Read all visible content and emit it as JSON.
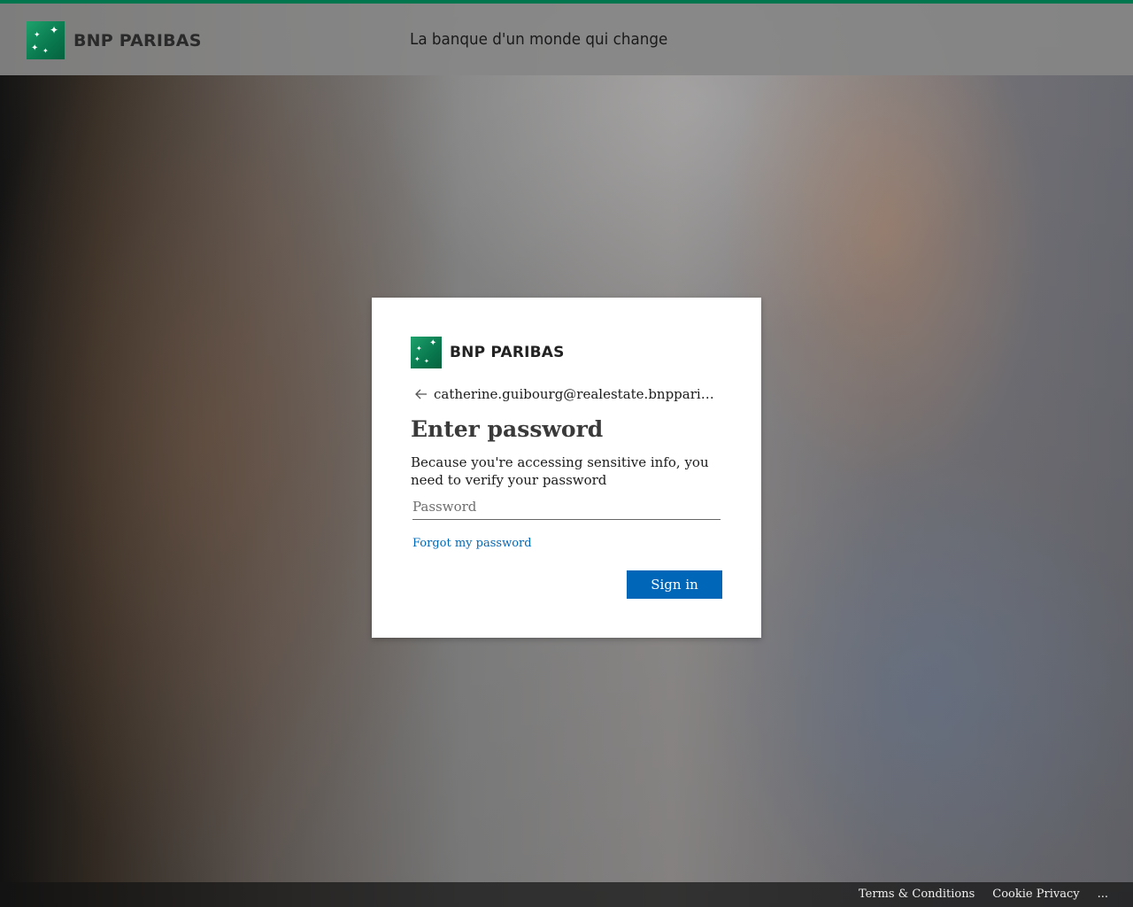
{
  "header": {
    "brand": "BNP PARIBAS",
    "tagline": "La banque d'un monde qui change",
    "accent_color": "#00764e"
  },
  "dialog": {
    "brand": "BNP PARIBAS",
    "identity": "catherine.guibourg@realestate.bnpparibas",
    "title": "Enter password",
    "description": "Because you're accessing sensitive info, you need to verify your password",
    "password_placeholder": "Password",
    "forgot_link": "Forgot my password",
    "signin_label": "Sign in",
    "primary_color": "#0067b8"
  },
  "footer": {
    "terms": "Terms & Conditions",
    "privacy": "Cookie Privacy",
    "more": "..."
  },
  "icons": {
    "brand_logo": "bnp-stars-logo-icon",
    "back": "back-arrow-icon"
  }
}
